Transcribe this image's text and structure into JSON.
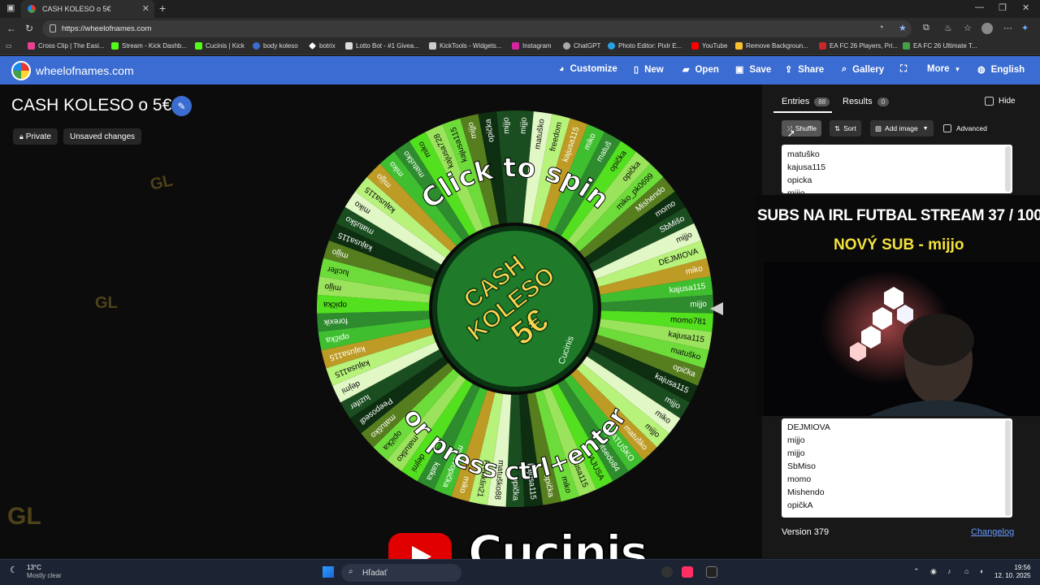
{
  "browser": {
    "tab_title": "CASH KOLESO o 5€",
    "url": "https://wheelofnames.com",
    "bookmarks": [
      "Cross Clip | The Easi...",
      "Stream - Kick Dashb...",
      "Cucinis | Kick",
      "body koleso",
      "botrix",
      "Lotto Bot - #1 Givea...",
      "KickTools - Widgets...",
      "Instagram",
      "ChatGPT",
      "Photo Editor: Pixlr E...",
      "YouTube",
      "Remove Backgroun...",
      "EA FC 26 Players, Pri...",
      "EA FC 26 Ultimate T..."
    ]
  },
  "site": {
    "name": "wheelofnames.com",
    "menu": [
      "Customize",
      "New",
      "Open",
      "Save",
      "Share",
      "Gallery",
      "More",
      "English"
    ]
  },
  "wheel": {
    "title": "CASH KOLESO o 5€",
    "private_label": "Private",
    "unsaved_label": "Unsaved changes",
    "click_text": "Click to spin",
    "press_text": "or press ctrl+enter",
    "center_text": [
      "CASH",
      "KOLESO",
      "5€"
    ],
    "center_sub": "Cucinis",
    "watermark": "GL",
    "slices": [
      "mijjo",
      "matuško",
      "freedom",
      "kajusa115",
      "miko",
      "matuš",
      "opička",
      "opička",
      "miko_pk0699",
      "Mishendo",
      "momo",
      "SbMišo",
      "mijjo",
      "DEJMIOVA",
      "miko",
      "kajusa115",
      "mijjo",
      "momo781",
      "kajusa115",
      "matuško",
      "opička",
      "kajusa115",
      "mijjo",
      "miko",
      "mijjo",
      "matuško",
      "MATUŠKO",
      "itsedo84",
      "KAJUSA",
      "kajusa115",
      "miko",
      "opička",
      "kajusa115",
      "opička",
      "matuško88",
      "Frenklin21",
      "miko",
      "mikovopička",
      "katka",
      "dejmi",
      "matuško",
      "opička",
      "matuško",
      "Peeposedl",
      "luzifer",
      "dejmi",
      "kajusa115",
      "kajusa115",
      "opička",
      "forexik",
      "opička",
      "mijjo",
      "lucifer",
      "mijjo",
      "kajusa115",
      "matuško",
      "miko",
      "kajusa115",
      "mijjo",
      "miko",
      "matuško",
      "miko",
      "kajusa728",
      "kajusa115",
      "mijjo",
      "opička",
      "mijjo"
    ]
  },
  "sidebar": {
    "entries_tab": "Entries",
    "entries_count": "88",
    "results_tab": "Results",
    "results_count": "0",
    "hide_label": "Hide",
    "shuffle": "Shuffle",
    "sort": "Sort",
    "add_image": "Add image",
    "advanced": "Advanced",
    "entries_top": [
      "matuško",
      "kajusa115",
      "opicka",
      "mijjo"
    ],
    "entries_bottom": [
      "DEJMIOVA",
      "mijjo",
      "mijjo",
      "SbMiso",
      "momo",
      "Mishendo",
      "opičkA"
    ],
    "version": "Version 379",
    "changelog": "Changelog"
  },
  "overlay": {
    "line1": "SUBS NA IRL FUTBAL STREAM  37 / 100",
    "line2": "NOVÝ SUB - mijjo"
  },
  "stream": {
    "channel": "Cucinis"
  },
  "taskbar": {
    "temp": "13°C",
    "weather": "Mostly clear",
    "search": "Hľadať",
    "time": "19:56",
    "date": "12. 10. 2025"
  }
}
